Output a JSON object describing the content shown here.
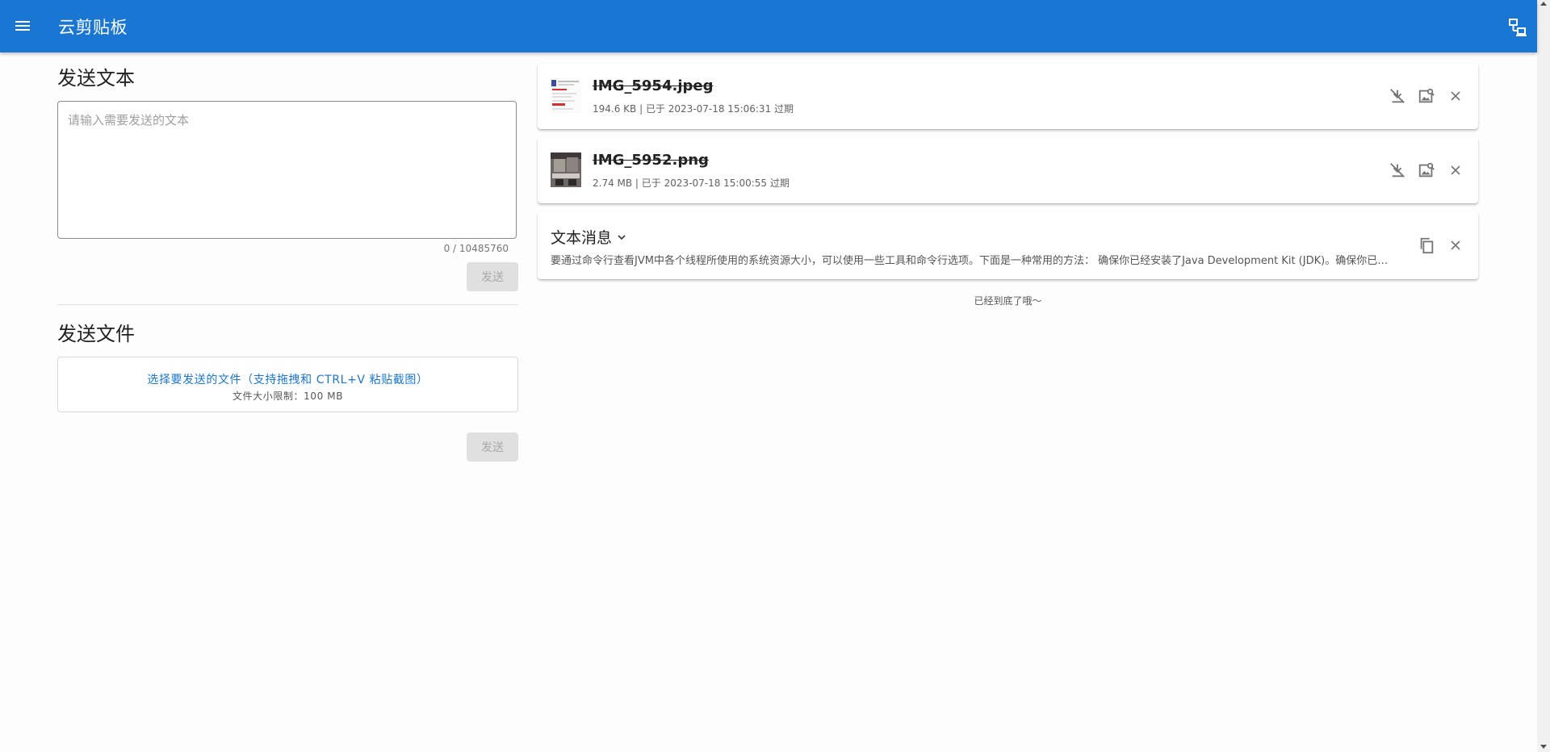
{
  "header": {
    "title": "云剪贴板",
    "menu_icon": "menu-icon",
    "device_icon": "devices-icon"
  },
  "send_text": {
    "title": "发送文本",
    "placeholder": "请输入需要发送的文本",
    "value": "",
    "counter": "0 / 10485760",
    "send_label": "发送"
  },
  "send_file": {
    "title": "发送文件",
    "select_label": "选择要发送的文件（支持拖拽和 CTRL+V 粘贴截图）",
    "size_limit": "文件大小限制：100 MB",
    "send_label": "发送"
  },
  "items": [
    {
      "name": "IMG_5954.jpeg",
      "meta": "194.6 KB | 已于 2023-07-18 15:06:31 过期"
    },
    {
      "name": "IMG_5952.png",
      "meta": "2.74 MB | 已于 2023-07-18 15:00:55 过期"
    }
  ],
  "text_message": {
    "title": "文本消息",
    "body": "要通过命令行查看JVM中各个线程所使用的系统资源大小，可以使用一些工具和命令行选项。下面是一种常用的方法： 确保你已经安装了Java Development Kit (JDK)。确保你已经安装了Java Development Kit (JDK)。"
  },
  "end_note": "已经到底了哦～",
  "colors": {
    "primary": "#1976d2",
    "disabled_button": "#e0e0e0"
  }
}
